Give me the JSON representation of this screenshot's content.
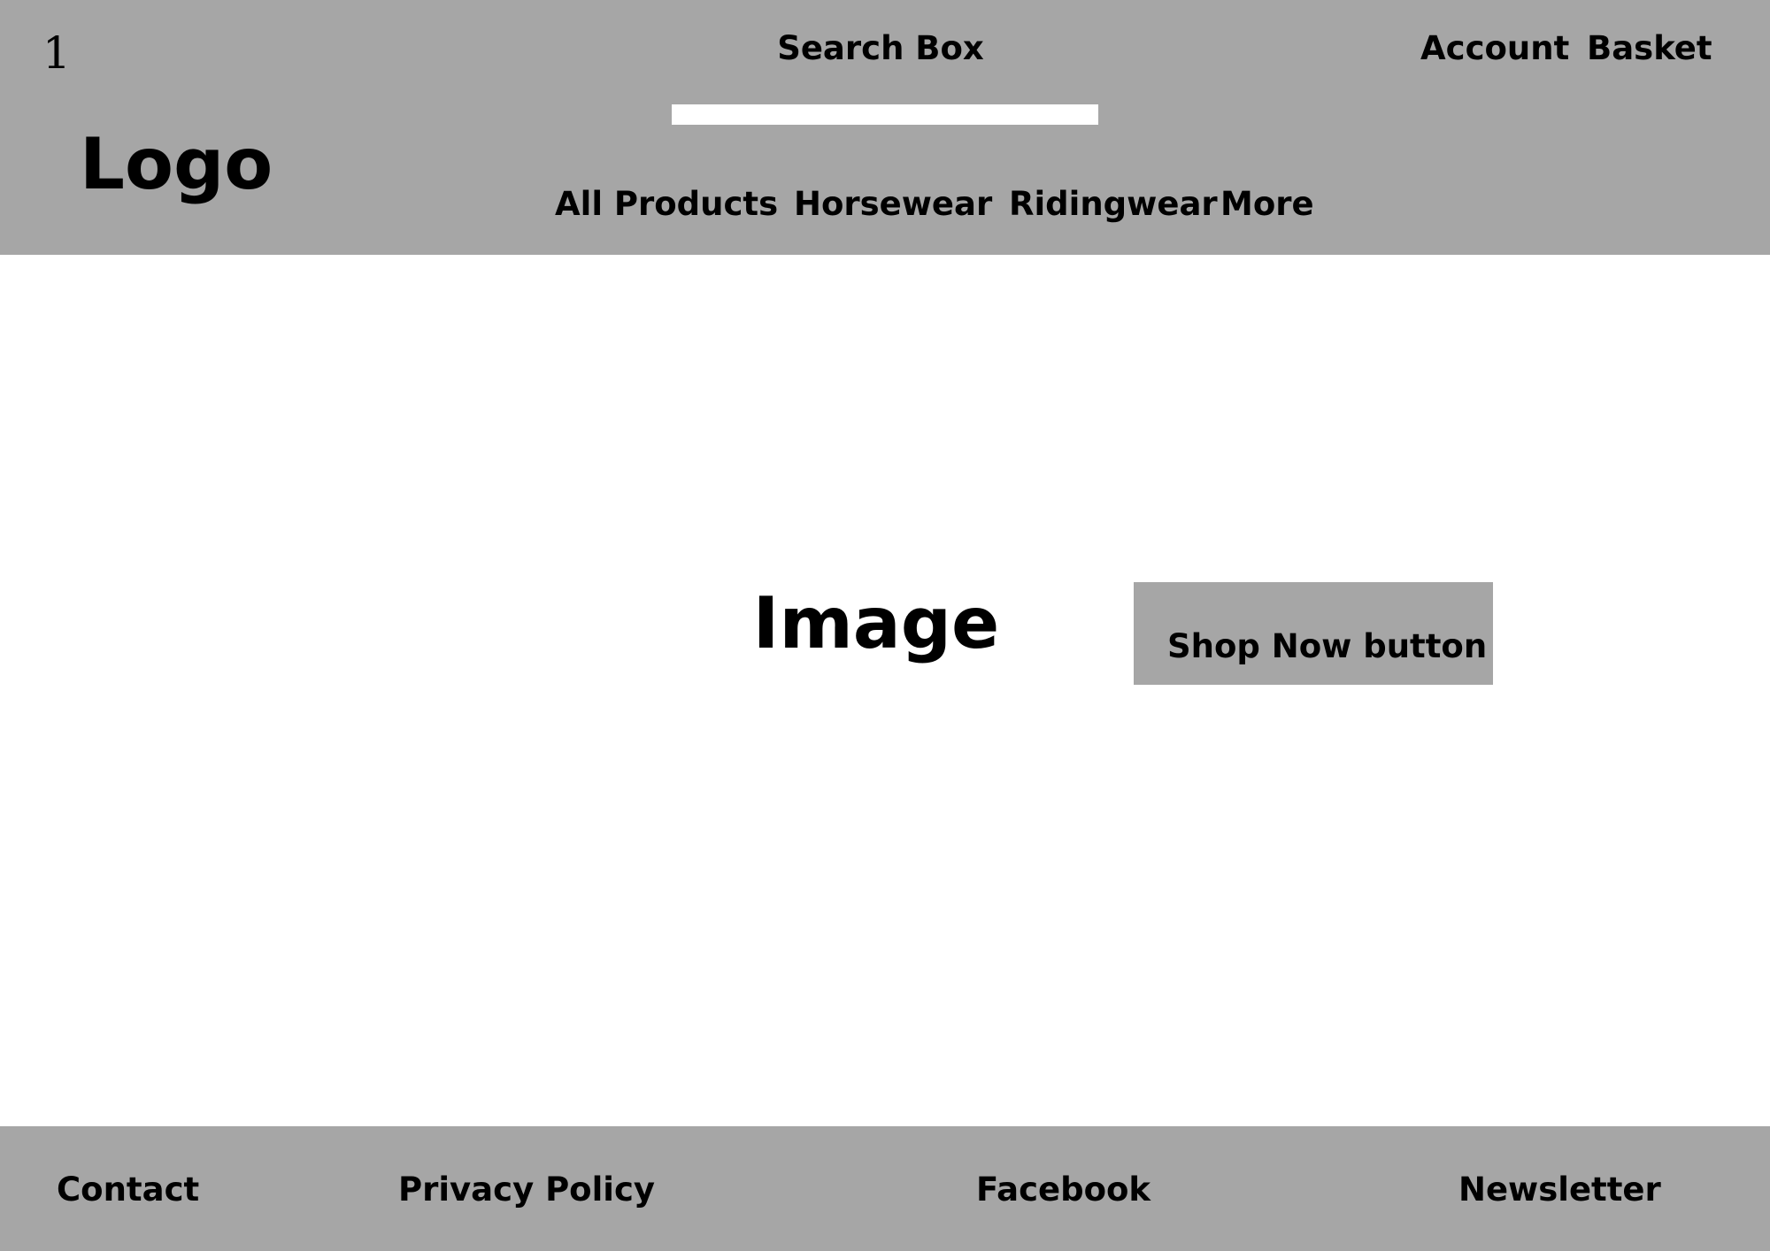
{
  "header": {
    "page_number": "1",
    "logo_text": "Logo",
    "search": {
      "label": "Search Box",
      "placeholder": ""
    },
    "account_label": "Account",
    "basket_label": "Basket",
    "nav": {
      "items": [
        {
          "label": "All Products"
        },
        {
          "label": "Horsewear"
        },
        {
          "label": "Ridingwear"
        },
        {
          "label": "More"
        }
      ]
    }
  },
  "hero": {
    "image_label": "Image",
    "shop_button_label": "Shop Now button"
  },
  "footer": {
    "links": [
      {
        "label": "Contact"
      },
      {
        "label": "Privacy Policy"
      },
      {
        "label": "Facebook"
      },
      {
        "label": "Newsletter"
      }
    ]
  },
  "colors": {
    "bar_gray": "#a6a6a6",
    "background": "#ffffff",
    "text": "#000000"
  }
}
